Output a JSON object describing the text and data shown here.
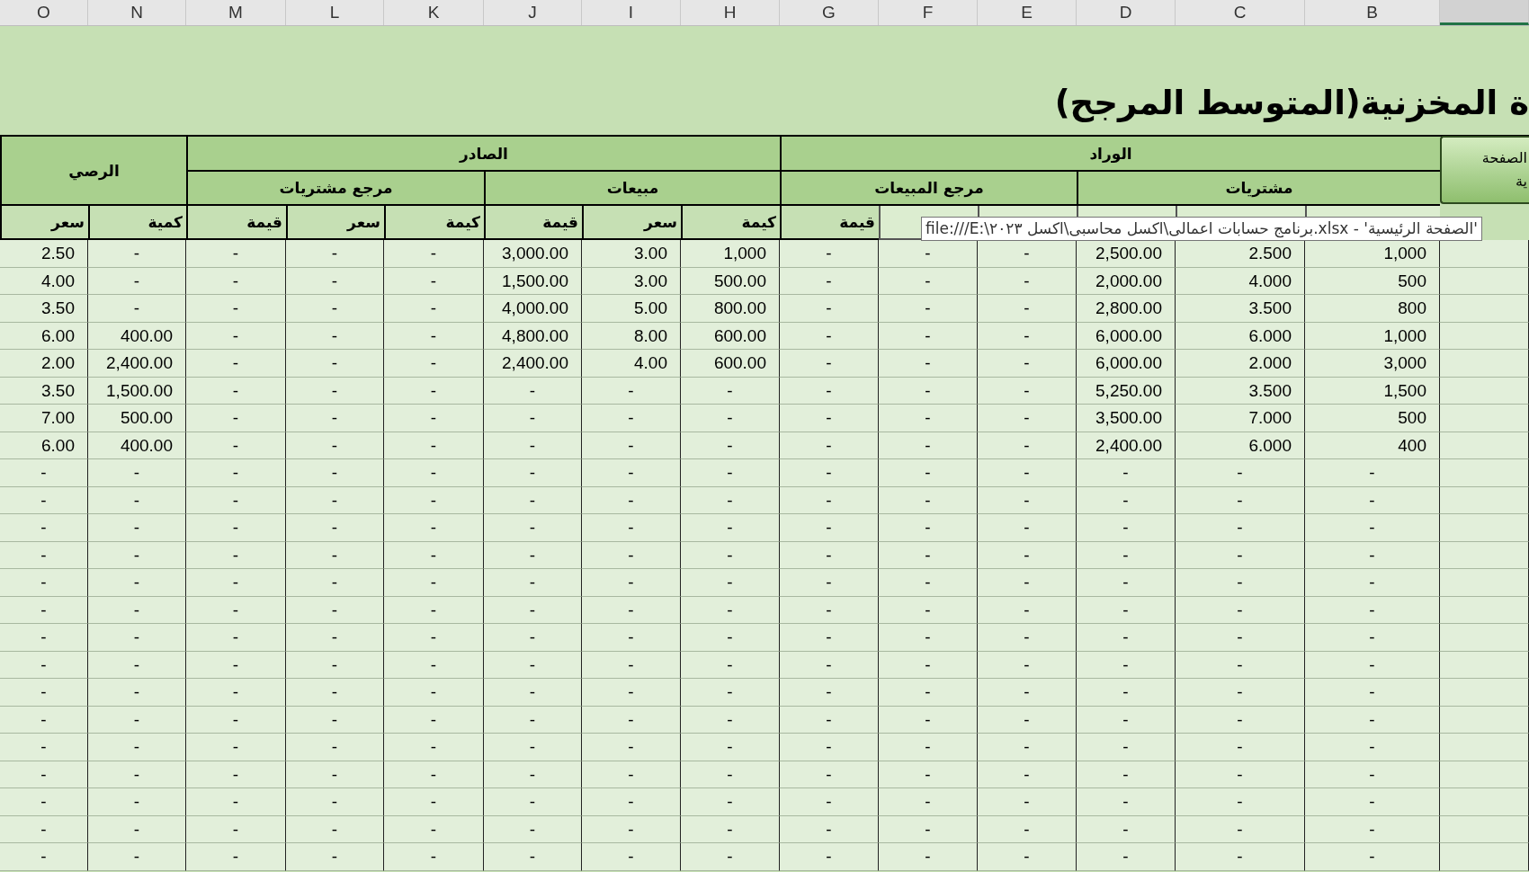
{
  "columns": [
    {
      "letter": "O",
      "selected": false
    },
    {
      "letter": "N",
      "selected": false
    },
    {
      "letter": "M",
      "selected": false
    },
    {
      "letter": "L",
      "selected": false
    },
    {
      "letter": "K",
      "selected": false
    },
    {
      "letter": "J",
      "selected": false
    },
    {
      "letter": "I",
      "selected": false
    },
    {
      "letter": "H",
      "selected": false
    },
    {
      "letter": "G",
      "selected": false
    },
    {
      "letter": "F",
      "selected": false
    },
    {
      "letter": "E",
      "selected": false
    },
    {
      "letter": "D",
      "selected": false
    },
    {
      "letter": "C",
      "selected": false
    },
    {
      "letter": "B",
      "selected": false
    },
    {
      "selected": true
    }
  ],
  "title": "ة المخزنية(المتوسط المرجح)",
  "home_button": {
    "lines": [
      "الصفحة",
      "ية"
    ]
  },
  "groups": [
    {
      "title": "الوراد",
      "subgroups": [
        {
          "title": "مشتريات",
          "headers": [
            {
              "covered": true
            },
            {
              "covered": true
            },
            {
              "covered": true
            }
          ]
        },
        {
          "title": "مرجع المبيعات",
          "headers": [
            {
              "covered": true
            },
            {
              "covered": true
            },
            {
              "label": "قيمة",
              "covered": false
            }
          ]
        }
      ]
    },
    {
      "title": "الصادر",
      "subgroups": [
        {
          "title": "مبيعات",
          "headers": [
            {
              "label": "كيمة",
              "covered": false
            },
            {
              "label": "سعر",
              "covered": false
            },
            {
              "label": "قيمة",
              "covered": false
            }
          ]
        },
        {
          "title": "مرجع مشتريات",
          "headers": [
            {
              "label": "كيمة",
              "covered": false
            },
            {
              "label": "سعر",
              "covered": false
            },
            {
              "label": "قيمة",
              "covered": false
            }
          ]
        }
      ]
    },
    {
      "title": "الرصي",
      "headers": [
        {
          "label": "كمية",
          "covered": false
        },
        {
          "label": "سعر",
          "covered": false
        }
      ]
    }
  ],
  "rows": [
    [
      "2.50",
      "-",
      "-",
      "-",
      "-",
      "3,000.00",
      "3.00",
      "1,000",
      "-",
      "-",
      "-",
      "2,500.00",
      "2.500",
      "1,000"
    ],
    [
      "4.00",
      "-",
      "-",
      "-",
      "-",
      "1,500.00",
      "3.00",
      "500.00",
      "-",
      "-",
      "-",
      "2,000.00",
      "4.000",
      "500"
    ],
    [
      "3.50",
      "-",
      "-",
      "-",
      "-",
      "4,000.00",
      "5.00",
      "800.00",
      "-",
      "-",
      "-",
      "2,800.00",
      "3.500",
      "800"
    ],
    [
      "6.00",
      "400.00",
      "-",
      "-",
      "-",
      "4,800.00",
      "8.00",
      "600.00",
      "-",
      "-",
      "-",
      "6,000.00",
      "6.000",
      "1,000"
    ],
    [
      "2.00",
      "2,400.00",
      "-",
      "-",
      "-",
      "2,400.00",
      "4.00",
      "600.00",
      "-",
      "-",
      "-",
      "6,000.00",
      "2.000",
      "3,000"
    ],
    [
      "3.50",
      "1,500.00",
      "-",
      "-",
      "-",
      "-",
      "-",
      "-",
      "-",
      "-",
      "-",
      "5,250.00",
      "3.500",
      "1,500"
    ],
    [
      "7.00",
      "500.00",
      "-",
      "-",
      "-",
      "-",
      "-",
      "-",
      "-",
      "-",
      "-",
      "3,500.00",
      "7.000",
      "500"
    ],
    [
      "6.00",
      "400.00",
      "-",
      "-",
      "-",
      "-",
      "-",
      "-",
      "-",
      "-",
      "-",
      "2,400.00",
      "6.000",
      "400"
    ],
    [
      "-",
      "-",
      "-",
      "-",
      "-",
      "-",
      "-",
      "-",
      "-",
      "-",
      "-",
      "-",
      "-",
      "-"
    ],
    [
      "-",
      "-",
      "-",
      "-",
      "-",
      "-",
      "-",
      "-",
      "-",
      "-",
      "-",
      "-",
      "-",
      "-"
    ],
    [
      "-",
      "-",
      "-",
      "-",
      "-",
      "-",
      "-",
      "-",
      "-",
      "-",
      "-",
      "-",
      "-",
      "-"
    ],
    [
      "-",
      "-",
      "-",
      "-",
      "-",
      "-",
      "-",
      "-",
      "-",
      "-",
      "-",
      "-",
      "-",
      "-"
    ],
    [
      "-",
      "-",
      "-",
      "-",
      "-",
      "-",
      "-",
      "-",
      "-",
      "-",
      "-",
      "-",
      "-",
      "-"
    ],
    [
      "-",
      "-",
      "-",
      "-",
      "-",
      "-",
      "-",
      "-",
      "-",
      "-",
      "-",
      "-",
      "-",
      "-"
    ],
    [
      "-",
      "-",
      "-",
      "-",
      "-",
      "-",
      "-",
      "-",
      "-",
      "-",
      "-",
      "-",
      "-",
      "-"
    ],
    [
      "-",
      "-",
      "-",
      "-",
      "-",
      "-",
      "-",
      "-",
      "-",
      "-",
      "-",
      "-",
      "-",
      "-"
    ],
    [
      "-",
      "-",
      "-",
      "-",
      "-",
      "-",
      "-",
      "-",
      "-",
      "-",
      "-",
      "-",
      "-",
      "-"
    ],
    [
      "-",
      "-",
      "-",
      "-",
      "-",
      "-",
      "-",
      "-",
      "-",
      "-",
      "-",
      "-",
      "-",
      "-"
    ],
    [
      "-",
      "-",
      "-",
      "-",
      "-",
      "-",
      "-",
      "-",
      "-",
      "-",
      "-",
      "-",
      "-",
      "-"
    ],
    [
      "-",
      "-",
      "-",
      "-",
      "-",
      "-",
      "-",
      "-",
      "-",
      "-",
      "-",
      "-",
      "-",
      "-"
    ],
    [
      "-",
      "-",
      "-",
      "-",
      "-",
      "-",
      "-",
      "-",
      "-",
      "-",
      "-",
      "-",
      "-",
      "-"
    ],
    [
      "-",
      "-",
      "-",
      "-",
      "-",
      "-",
      "-",
      "-",
      "-",
      "-",
      "-",
      "-",
      "-",
      "-"
    ],
    [
      "-",
      "-",
      "-",
      "-",
      "-",
      "-",
      "-",
      "-",
      "-",
      "-",
      "-",
      "-",
      "-",
      "-"
    ]
  ],
  "tooltip": "file:///E:\\برنامج حسابات اعمالى\\اكسل محاسبى\\اكسل ٢٠٢٣.xlsx - 'الصفحة الرئيسية'"
}
